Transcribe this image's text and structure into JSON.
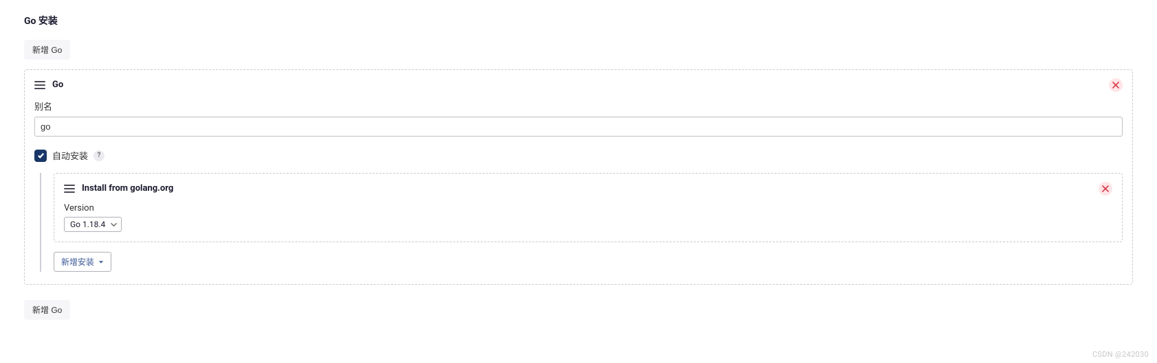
{
  "section": {
    "title": "Go 安装"
  },
  "buttons": {
    "add_go_top": "新增 Go",
    "add_go_bottom": "新增 Go",
    "add_installer": "新增安装"
  },
  "installation": {
    "header": "Go",
    "alias_label": "别名",
    "alias_value": "go",
    "auto_install_label": "自动安装",
    "help_symbol": "?"
  },
  "installer": {
    "title": "Install from golang.org",
    "version_label": "Version",
    "version_selected": "Go 1.18.4"
  },
  "watermark": "CSDN @242030"
}
